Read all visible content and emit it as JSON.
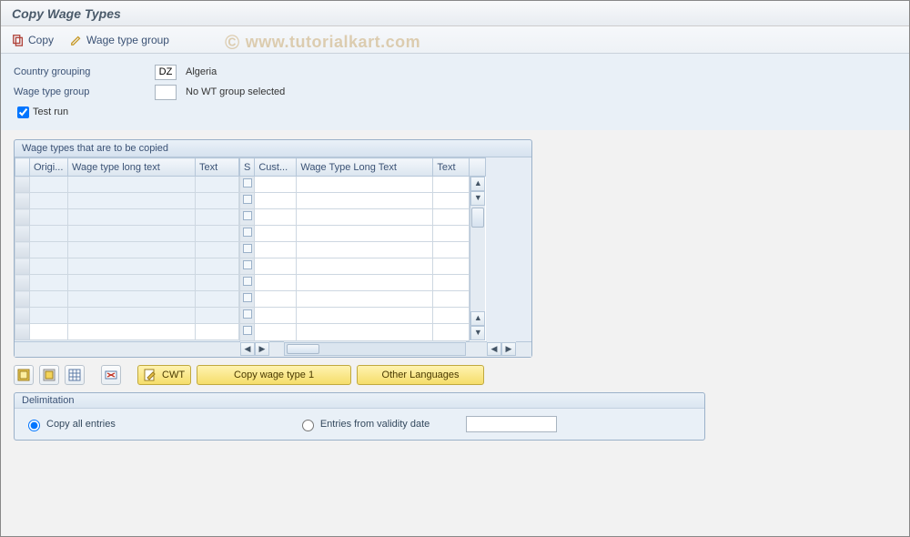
{
  "title": "Copy Wage Types",
  "toolbar": {
    "copy_label": "Copy",
    "wage_group_label": "Wage type group"
  },
  "watermark": "www.tutorialkart.com",
  "form": {
    "country_label": "Country grouping",
    "country_code": "DZ",
    "country_name": "Algeria",
    "wage_group_label": "Wage type group",
    "wage_group_value": "",
    "wage_group_text": "No WT group selected",
    "testrun_label": "Test run",
    "testrun_checked": true
  },
  "table": {
    "title": "Wage types that are to be copied",
    "cols_left": [
      "Origi...",
      "Wage type long text",
      "Text"
    ],
    "cols_right": [
      "S",
      "Cust...",
      "Wage Type Long Text",
      "Text"
    ],
    "row_count": 10
  },
  "buttons": {
    "cwt_label": "CWT",
    "copy1_label": "Copy wage type 1",
    "other_lang_label": "Other Languages"
  },
  "delimitation": {
    "title": "Delimitation",
    "opt_all": "Copy all entries",
    "opt_from": "Entries from validity date"
  }
}
